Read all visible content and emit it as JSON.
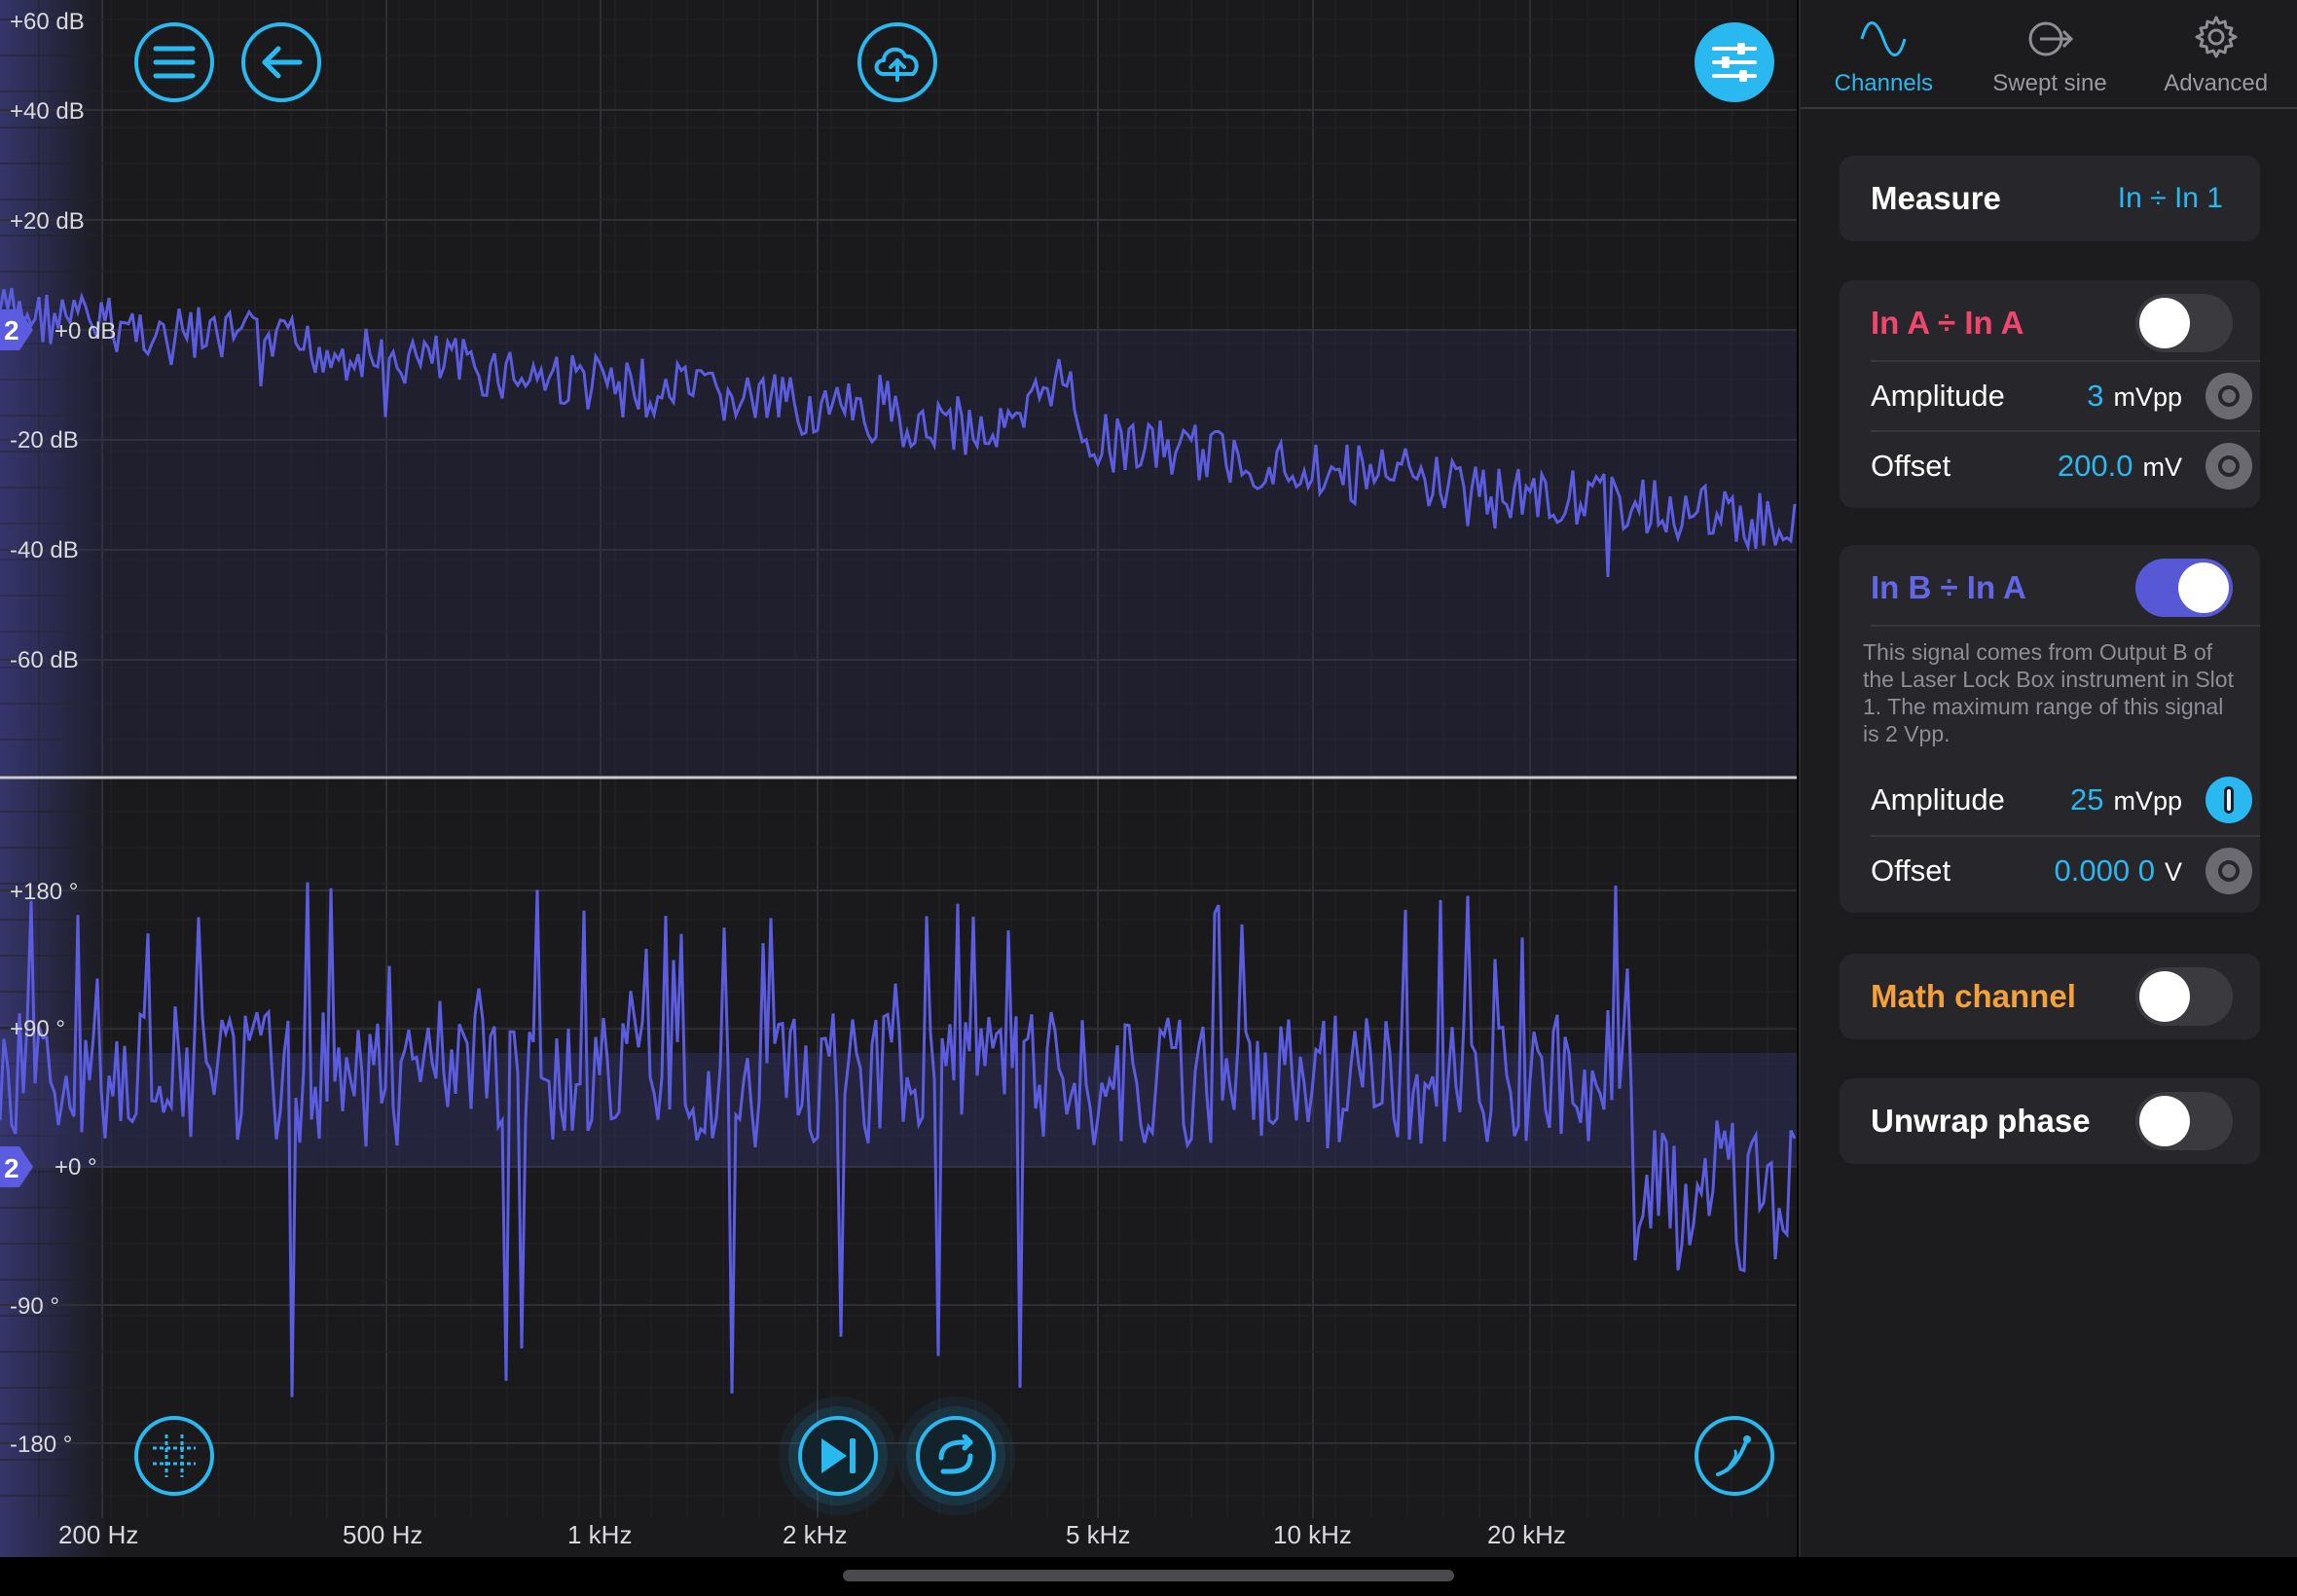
{
  "top_plot": {
    "y_labels": [
      "+60 dB",
      "+40 dB",
      "+20 dB",
      "+0 dB",
      "-20 dB",
      "-40 dB",
      "-60 dB"
    ],
    "marker": "2"
  },
  "bottom_plot": {
    "y_labels": [
      "+180 °",
      "+90 °",
      "+0 °",
      "-90 °",
      "-180 °"
    ],
    "marker": "2"
  },
  "x_labels": [
    "200 Hz",
    "500 Hz",
    "1 kHz",
    "2 kHz",
    "5 kHz",
    "10 kHz",
    "20 kHz"
  ],
  "toolbar": {
    "menu_icon": "hamburger-icon",
    "back_icon": "arrow-left-icon",
    "upload_icon": "cloud-upload-icon",
    "settings_icon": "sliders-icon",
    "grid_icon": "crosshair-grid-icon",
    "play_icon": "play-next-icon",
    "repeat_icon": "repeat-icon",
    "probe_icon": "probe-icon"
  },
  "tabs": [
    {
      "label": "Channels",
      "icon": "sine-wave-icon",
      "active": true
    },
    {
      "label": "Swept sine",
      "icon": "swept-sine-icon",
      "active": false
    },
    {
      "label": "Advanced",
      "icon": "gear-icon",
      "active": false
    }
  ],
  "measure": {
    "label": "Measure",
    "value": "In ÷ In 1"
  },
  "channel_a": {
    "title": "In A ÷ In A",
    "enabled": false,
    "amplitude_label": "Amplitude",
    "amplitude_value": "3",
    "amplitude_unit": "mVpp",
    "offset_label": "Offset",
    "offset_value": "200.0",
    "offset_unit": "mV"
  },
  "channel_b": {
    "title": "In B ÷ In A",
    "enabled": true,
    "description": "This signal comes from Output B of the Laser Lock Box instrument in Slot 1. The maximum range of this signal is 2 Vpp.",
    "amplitude_label": "Amplitude",
    "amplitude_value": "25",
    "amplitude_unit": "mVpp",
    "offset_label": "Offset",
    "offset_value": "0.000 0",
    "offset_unit": "V"
  },
  "math_channel": {
    "label": "Math channel",
    "enabled": false
  },
  "unwrap_phase": {
    "label": "Unwrap phase",
    "enabled": false
  },
  "colors": {
    "accent": "#29b8f0",
    "trace": "#5b5ce0",
    "channel_a": "#f0466e",
    "channel_b": "#6466e8",
    "math": "#f5a13a"
  }
}
